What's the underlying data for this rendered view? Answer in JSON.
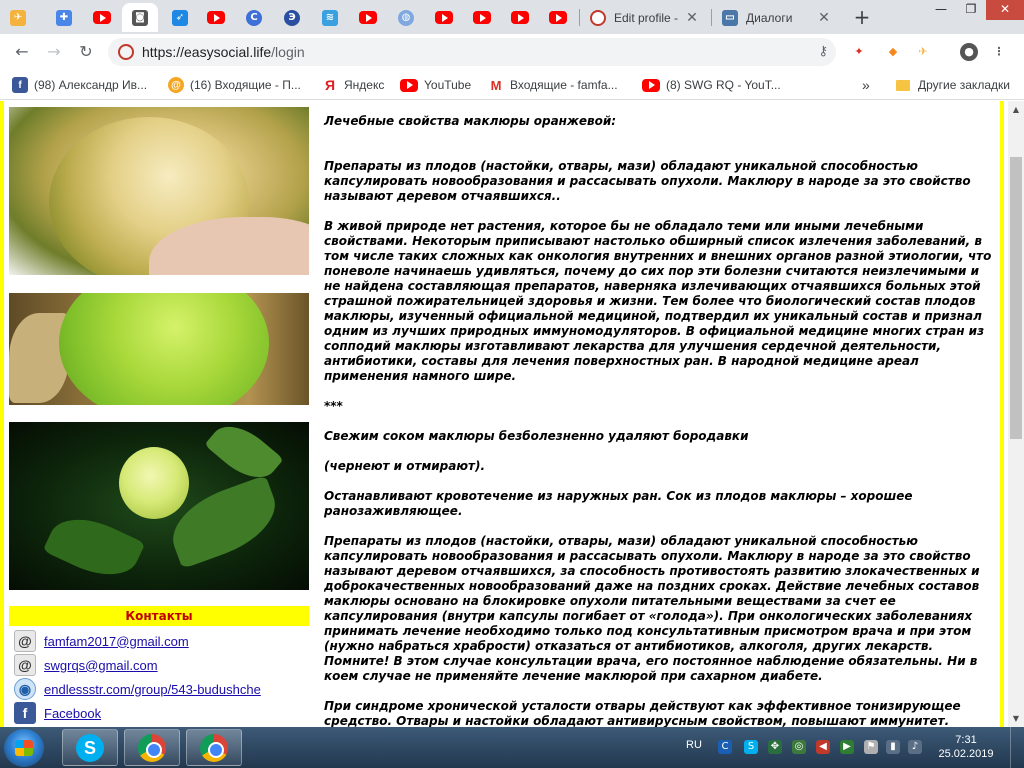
{
  "browser": {
    "tabs": [
      {
        "title": "Edit profile - ",
        "active": false
      },
      {
        "title": "Диалоги",
        "active": false
      }
    ],
    "new_tab_label": "+",
    "window_controls": {
      "minimize": "—",
      "restore": "❐",
      "close": "✕"
    },
    "url": {
      "host": "https://easysocial.life",
      "path": "/login"
    }
  },
  "bookmarks": [
    {
      "label": "(98) Александр Ив...",
      "icon": "facebook-icon"
    },
    {
      "label": "(16) Входящие - П...",
      "icon": "mail-icon"
    },
    {
      "label": "Яндекс",
      "icon": "yandex-icon"
    },
    {
      "label": "YouTube",
      "icon": "youtube-icon"
    },
    {
      "label": "Входящие - famfa...",
      "icon": "gmail-icon"
    },
    {
      "label": "(8) SWG RQ - YouT...",
      "icon": "youtube-icon"
    }
  ],
  "bookmarks_more": "»",
  "bookmarks_other": "Другие закладки",
  "sidebar": {
    "contacts_title": "Контакты",
    "contacts": [
      {
        "text": "famfam2017@gmail.com",
        "icon": "email-icon"
      },
      {
        "text": "swgrqs@gmail.com",
        "icon": "email-icon"
      },
      {
        "text": "endlessstr.com/group/543-budushche",
        "icon": "globe-icon"
      },
      {
        "text": "Facebook",
        "icon": "facebook-icon"
      }
    ]
  },
  "article": {
    "heading": "Лечебные свойства маклюры оранжевой:",
    "p1": "Препараты из плодов (настойки, отвары, мази) обладают уникальной способностью капсулировать новообразования и рассасывать опухоли. Маклюру в народе за это свойство называют деревом отчаявшихся..",
    "p2": "В живой природе нет растения, которое бы не обладало теми или иными лечебными свойствами. Некоторым приписывают настолько обширный список излечения заболеваний, в том числе таких сложных как онкология внутренних и внешних органов разной этиологии, что поневоле начинаешь удивляться, почему до сих пор эти болезни считаются неизлечимыми и не найдена составляющая препаратов, наверняка излечивающих отчаявшихся больных этой страшной пожирательницей здоровья и жизни. Тем более что биологический состав плодов маклюры, изученный официальной медициной, подтвердил их уникальный состав и признал одним из лучших природных иммуномодуляторов. В официальной медицине многих стран из сопподий маклюры изготавливают лекарства для улучшения сердечной деятельности, антибиотики, составы для лечения поверхностных ран. В народной медицине ареал применения намного шире.",
    "separator": "***",
    "p3": "Свежим соком маклюры безболезненно удаляют бородавки",
    "p4": "(чернеют и отмирают).",
    "p5": "Останавливают кровотечение из наружных ран. Сок из плодов маклюры – хорошее ранозаживляющее.",
    "p6": "Препараты из плодов (настойки, отвары, мази) обладают уникальной способностью капсулировать новообразования и рассасывать опухоли. Маклюру в народе за это свойство называют деревом отчаявшихся, за способность противостоять развитию злокачественных и доброкачественных новообразований даже на поздних сроках. Действие лечебных составов маклюры основано на блокировке опухоли питательными веществами за счет ее капсулирования (внутри капсулы погибает от «голода»). При онкологических заболеваниях принимать лечение необходимо только под консультативным присмотром врача и при этом (нужно набраться храбрости) отказаться от антибиотиков, алкоголя, других лекарств. Помните! В этом случае консультации врача, его постоянное наблюдение обязательны. Ни в коем случае не применяйте лечение маклюрой при сахарном диабете.",
    "p7": "При синдроме хронической усталости отвары действуют как эффективное тонизирующее средство. Отвары и настойки обладают антивирусным свойством, повышают иммунитет."
  },
  "taskbar": {
    "language": "RU",
    "time": "7:31",
    "date": "25.02.2019",
    "apps": [
      "skype-icon",
      "chrome-icon",
      "chrome-icon"
    ]
  },
  "colors": {
    "page_accent": "#ffff00",
    "contacts_title": "#c00000",
    "link": "#1a0dab"
  }
}
